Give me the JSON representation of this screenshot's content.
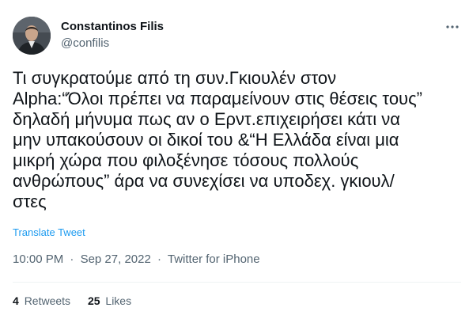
{
  "author": {
    "name": "Constantinos Filis",
    "handle": "@confilis",
    "avatar_icon": "profile-photo"
  },
  "more_icon": "more-horizontal-icon",
  "tweet": {
    "lines": [
      "Τι συγκρατούμε από τη συν.Γκιουλέν στον",
      "Alpha:“Όλοι πρέπει να παραμείνουν στις θέσεις τους”",
      "δηλαδή μήνυμα πως αν ο Ερντ.επιχειρήσει κάτι να",
      "μην υπακούσουν οι δικοί του &“Η Ελλάδα είναι μια",
      "μικρή χώρα που φιλοξένησε τόσους πολλούς",
      "ανθρώπους” άρα να συνεχίσει να υποδεχ. γκιουλ/",
      "στες"
    ],
    "translate_label": "Translate Tweet"
  },
  "meta": {
    "time": "10:00 PM",
    "separator": "·",
    "date": "Sep 27, 2022",
    "source": "Twitter for iPhone"
  },
  "stats": {
    "retweets_count": "4",
    "retweets_label": "Retweets",
    "likes_count": "25",
    "likes_label": "Likes"
  },
  "colors": {
    "text": "#0f1419",
    "secondary": "#536471",
    "link": "#1d9bf0",
    "divider": "#eff3f4"
  }
}
